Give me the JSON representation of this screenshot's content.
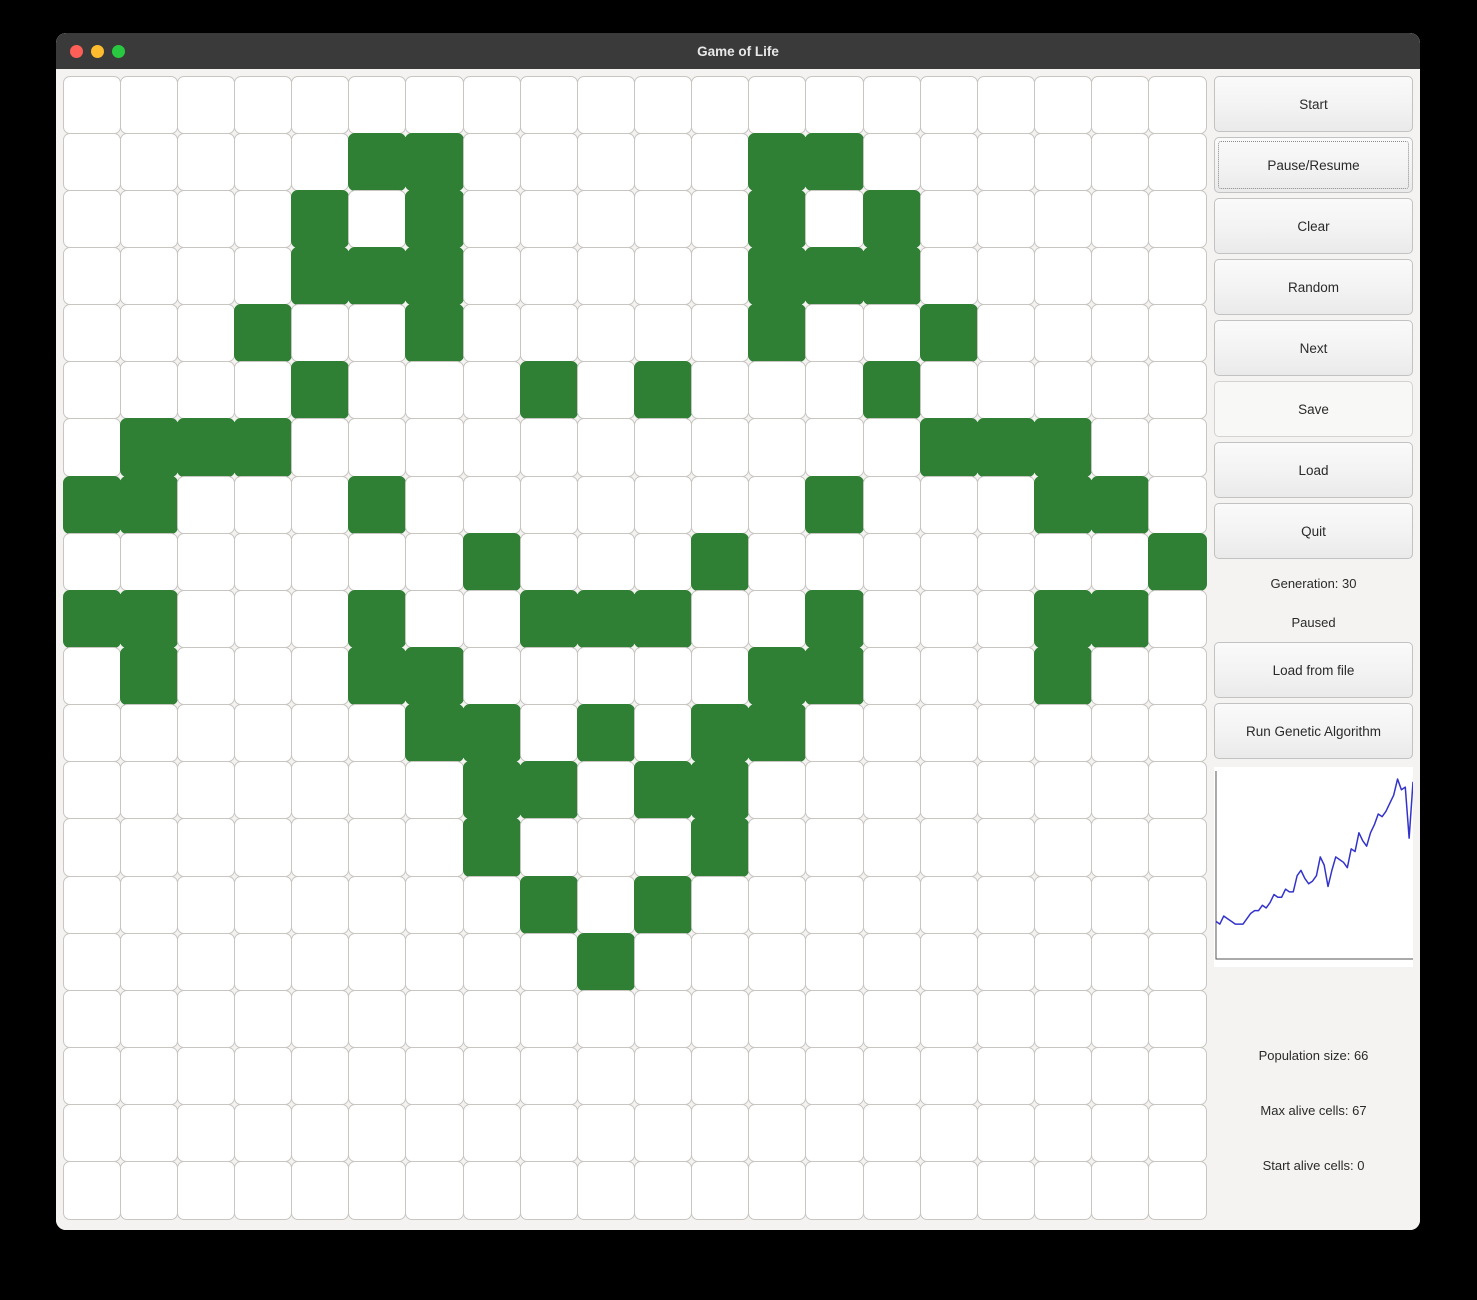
{
  "window": {
    "title": "Game of Life",
    "traffic_lights": [
      "close",
      "minimize",
      "maximize"
    ]
  },
  "sidebar": {
    "buttons": [
      {
        "label": "Start",
        "name": "start-button",
        "focused": false,
        "flat": false
      },
      {
        "label": "Pause/Resume",
        "name": "pause-resume-button",
        "focused": true,
        "flat": false
      },
      {
        "label": "Clear",
        "name": "clear-button",
        "focused": false,
        "flat": false
      },
      {
        "label": "Random",
        "name": "random-button",
        "focused": false,
        "flat": false
      },
      {
        "label": "Next",
        "name": "next-button",
        "focused": false,
        "flat": false
      },
      {
        "label": "Save",
        "name": "save-button",
        "focused": false,
        "flat": true
      },
      {
        "label": "Load",
        "name": "load-button",
        "focused": false,
        "flat": false
      },
      {
        "label": "Quit",
        "name": "quit-button",
        "focused": false,
        "flat": false
      }
    ],
    "generation_label": "Generation: 30",
    "state_label": "Paused",
    "buttons2": [
      {
        "label": "Load from file",
        "name": "load-from-file-button"
      },
      {
        "label": "Run Genetic Algorithm",
        "name": "run-genetic-algorithm-button"
      }
    ],
    "stats": [
      "Population size: 66",
      "Max alive cells: 67",
      "Start alive cells: 0"
    ]
  },
  "colors": {
    "alive_cell": "#2f8034",
    "dead_cell": "#ffffff",
    "cell_border": "#c9c6c2",
    "chart_line": "#3333cc",
    "chart_axis": "#555555",
    "titlebar": "#3a3a3a",
    "panel_bg": "#f4f3f1"
  },
  "grid": {
    "rows": 20,
    "cols": 20,
    "alive": [
      [],
      [
        5,
        6,
        12,
        13
      ],
      [
        4,
        6,
        12,
        14
      ],
      [
        4,
        5,
        6,
        12,
        13,
        14
      ],
      [
        3,
        6,
        12,
        15
      ],
      [
        4,
        8,
        10,
        14
      ],
      [
        1,
        2,
        3,
        15,
        16,
        17
      ],
      [
        0,
        1,
        5,
        13,
        17,
        18
      ],
      [
        7,
        11,
        19
      ],
      [
        0,
        1,
        5,
        8,
        9,
        10,
        13,
        17,
        18
      ],
      [
        1,
        5,
        6,
        12,
        13,
        17
      ],
      [
        6,
        7,
        9,
        11,
        12
      ],
      [
        7,
        8,
        10,
        11
      ],
      [
        7,
        11
      ],
      [
        8,
        10
      ],
      [
        9
      ],
      [],
      [],
      [],
      []
    ]
  },
  "chart_data": {
    "type": "line",
    "title": "",
    "xlabel": "",
    "ylabel": "",
    "grid": false,
    "legend": null,
    "series": [
      {
        "name": "Max alive cells",
        "color": "#3333cc",
        "x": [
          0,
          1,
          2,
          3,
          4,
          5,
          6,
          7,
          8,
          9,
          10,
          11,
          12,
          13,
          14,
          15,
          16,
          17,
          18,
          19,
          20,
          21,
          22,
          23,
          24,
          25,
          26,
          27,
          28,
          29,
          30,
          31,
          32,
          33,
          34,
          35,
          36,
          37,
          38,
          39,
          40,
          41,
          42,
          43,
          44,
          45,
          46,
          47,
          48,
          49,
          50,
          51
        ],
        "values": [
          14,
          13,
          16,
          15,
          14,
          13,
          13,
          13,
          15,
          17,
          18,
          18,
          20,
          19,
          21,
          24,
          23,
          23,
          26,
          25,
          25,
          31,
          33,
          30,
          28,
          29,
          31,
          38,
          35,
          27,
          33,
          38,
          37,
          36,
          34,
          41,
          40,
          47,
          44,
          42,
          47,
          50,
          54,
          53,
          55,
          58,
          61,
          67,
          63,
          64,
          45,
          66
        ]
      }
    ],
    "xlim": [
      0,
      51
    ],
    "ylim": [
      0,
      70
    ]
  }
}
